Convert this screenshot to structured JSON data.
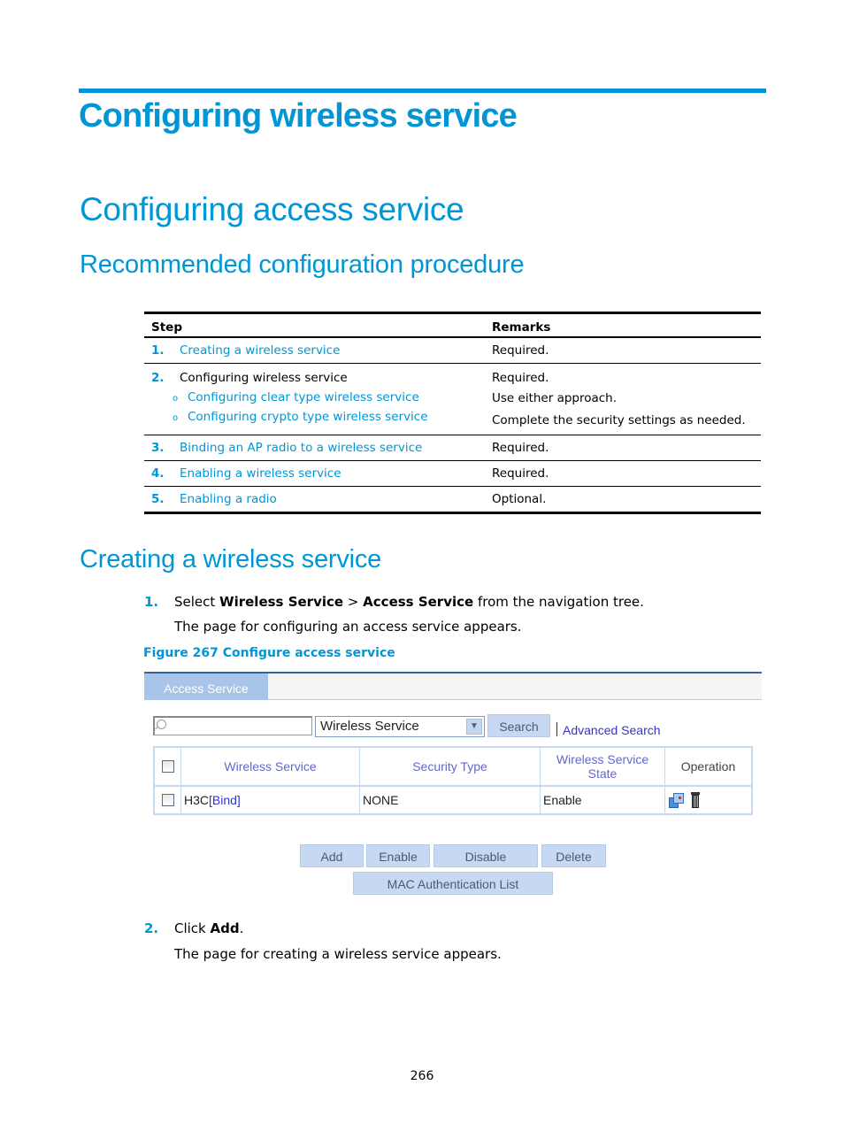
{
  "chapter": {
    "title": "Configuring wireless service"
  },
  "section": {
    "title": "Configuring access service"
  },
  "subsections": {
    "procedure_title": "Recommended configuration procedure",
    "creating_title": "Creating a wireless service"
  },
  "procedure_table": {
    "headers": {
      "step": "Step",
      "remarks": "Remarks"
    },
    "rows": [
      {
        "num": "1.",
        "step": "Creating a wireless service",
        "step_is_link": true,
        "subitems": [],
        "remarks": [
          "Required."
        ]
      },
      {
        "num": "2.",
        "step": "Configuring wireless service",
        "step_is_link": false,
        "subitems": [
          "Configuring clear type wireless service",
          "Configuring crypto type wireless service"
        ],
        "remarks": [
          "Required.",
          "Use either approach.",
          "Complete the security settings as needed."
        ]
      },
      {
        "num": "3.",
        "step": "Binding an AP radio to a wireless service",
        "step_is_link": true,
        "subitems": [],
        "remarks": [
          "Required."
        ]
      },
      {
        "num": "4.",
        "step": "Enabling a wireless service",
        "step_is_link": true,
        "subitems": [],
        "remarks": [
          "Required."
        ]
      },
      {
        "num": "5.",
        "step": "Enabling a radio",
        "step_is_link": true,
        "subitems": [],
        "remarks": [
          "Optional."
        ]
      }
    ],
    "bullet_glyph": "o"
  },
  "steps": [
    {
      "num": "1.",
      "prefix": "Select ",
      "bold1": "Wireless Service",
      "sep": " > ",
      "bold2": "Access Service",
      "suffix": " from the navigation tree.",
      "note": "The page for configuring an access service appears."
    },
    {
      "num": "2.",
      "prefix": "Click ",
      "bold1": "Add",
      "suffix": ".",
      "note": "The page for creating a wireless service appears."
    }
  ],
  "figure": {
    "caption": "Figure 267 Configure access service",
    "tab_label": "Access Service",
    "search": {
      "value": "",
      "placeholder": ""
    },
    "select_value": "Wireless Service",
    "search_button": "Search",
    "advanced_search": "Advanced Search",
    "grid": {
      "columns": [
        "Wireless Service",
        "Security Type",
        "Wireless Service State",
        "Operation"
      ],
      "rows": [
        {
          "name": "H3C",
          "bind_label": "[Bind]",
          "security": "NONE",
          "state": "Enable"
        }
      ]
    },
    "buttons": {
      "add": "Add",
      "enable": "Enable",
      "disable": "Disable",
      "delete": "Delete",
      "mac_list": "MAC Authentication List"
    }
  },
  "page_number": "266",
  "colors": {
    "accent": "#0096d6",
    "tab_active": "#a8c4e8",
    "button_bg": "#c7d8f2",
    "link_purple": "#3333cc"
  }
}
